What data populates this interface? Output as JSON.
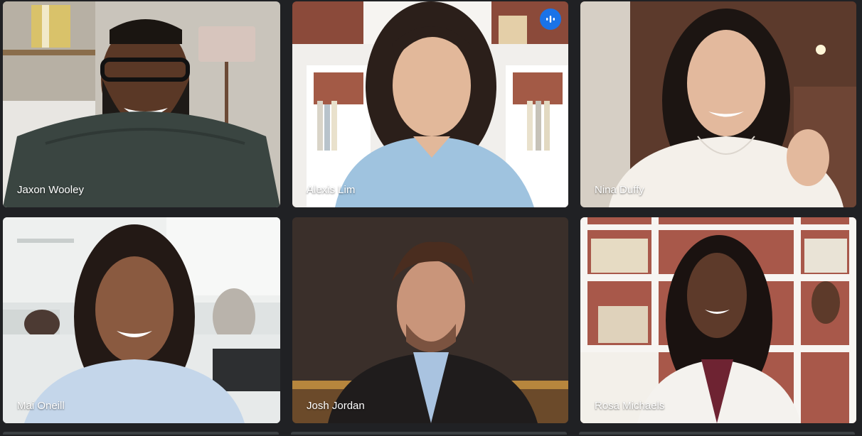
{
  "participants": [
    {
      "name": "Jaxon Wooley",
      "speaking": false
    },
    {
      "name": "Alexis Lim",
      "speaking": true
    },
    {
      "name": "Nina Duffy",
      "speaking": false
    },
    {
      "name": "Mai Oneill",
      "speaking": false
    },
    {
      "name": "Josh Jordan",
      "speaking": false
    },
    {
      "name": "Rosa Michaels",
      "speaking": false
    }
  ],
  "icons": {
    "speaking_indicator": "audio-wave-icon"
  },
  "colors": {
    "background": "#202124",
    "speaking_badge": "#1a73e8",
    "name_text": "#ffffff"
  }
}
